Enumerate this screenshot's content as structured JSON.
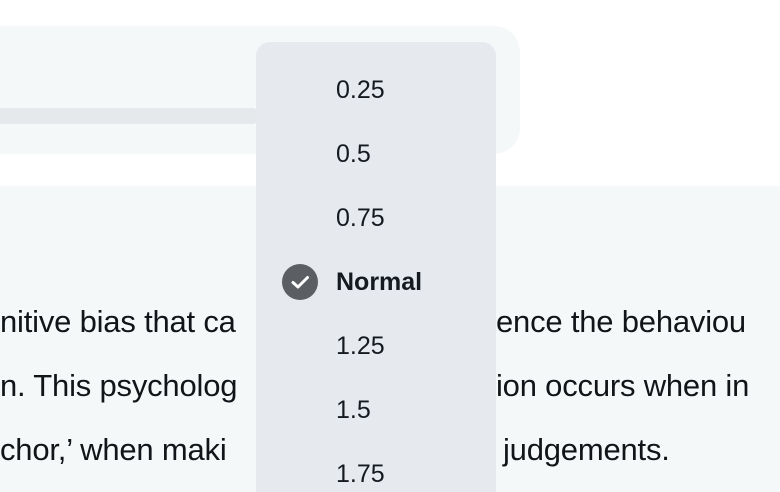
{
  "article": {
    "lines": [
      "nitive bias that ca",
      "n. This psycholog",
      "chor,’ when maki"
    ],
    "lines_right": [
      "ence the behaviou",
      "ion occurs when in",
      "judgements."
    ]
  },
  "speed_menu": {
    "selected": "Normal",
    "check_icon": "check-circle-icon",
    "options": [
      {
        "label": "0.25"
      },
      {
        "label": "0.5"
      },
      {
        "label": "0.75"
      },
      {
        "label": "Normal"
      },
      {
        "label": "1.25"
      },
      {
        "label": "1.5"
      },
      {
        "label": "1.75"
      }
    ]
  },
  "colors": {
    "menu_bg": "#e6e9ee",
    "card_bg": "#f5f8f9",
    "check_bg": "#5b5e63",
    "text": "#141a1f"
  }
}
